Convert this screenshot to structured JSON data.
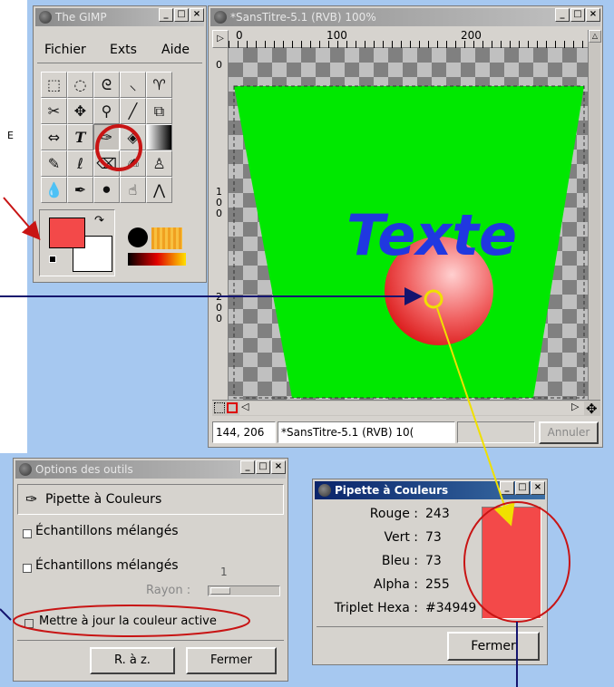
{
  "gimp_toolbox": {
    "title": "The GIMP",
    "menu": [
      "Fichier",
      "Exts",
      "Aide"
    ]
  },
  "image_window": {
    "title": "*SansTitre-5.1 (RVB) 100%",
    "ruler_top": [
      "0",
      "100",
      "200"
    ],
    "ruler_left": [
      "0",
      "1",
      "0",
      "0",
      "2",
      "0",
      "0"
    ],
    "canvas_text": "Texte",
    "status_coords": "144, 206",
    "status_title": "*SansTitre-5.1 (RVB) 10(",
    "cancel_label": "Annuler"
  },
  "tool_options": {
    "title": "Options des outils",
    "tool_name": "Pipette à Couleurs",
    "option1": "Échantillons mélangés",
    "option2": "Échantillons mélangés",
    "slider_value": "1",
    "rayon_label": "Rayon :",
    "update_label": "Mettre à jour la couleur active",
    "reset_label": "R. à z.",
    "close_label": "Fermer"
  },
  "color_picker": {
    "title": "Pipette à Couleurs",
    "rows": [
      {
        "label": "Rouge :",
        "value": "243"
      },
      {
        "label": "Vert :",
        "value": "73"
      },
      {
        "label": "Bleu :",
        "value": "73"
      },
      {
        "label": "Alpha :",
        "value": "255"
      },
      {
        "label": "Triplet Hexa :",
        "value": "#34949"
      }
    ],
    "close_label": "Fermer"
  },
  "side_text": "E",
  "colors": {
    "picked": "#f34949",
    "canvas_green": "#00e800",
    "annotation_red": "#c81414",
    "annotation_navy": "#14146e",
    "annotation_yellow": "#f0e000",
    "desktop_blue": "#a6c8f0"
  }
}
